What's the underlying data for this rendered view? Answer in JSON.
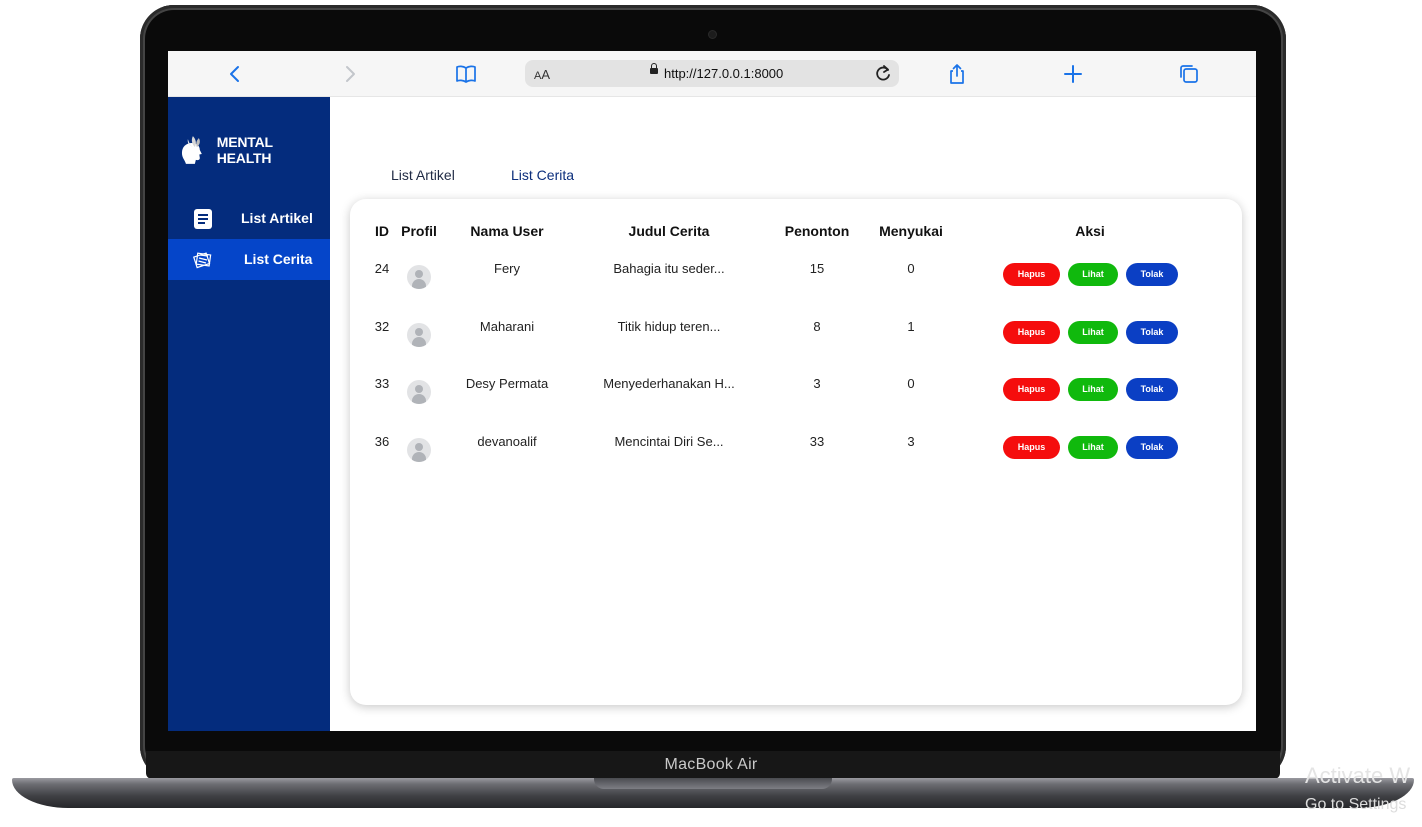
{
  "device": {
    "brand_label": "MacBook Air"
  },
  "os_watermark": {
    "line1": "Activate W",
    "line2": "Go to Settings"
  },
  "browser": {
    "text_size_label_small": "A",
    "text_size_label_large": "A",
    "url": "http://127.0.0.1:8000"
  },
  "sidebar": {
    "logo_text": "MENTAL HEALTH",
    "items": [
      {
        "label": "List Artikel",
        "icon": "document-icon",
        "active": false
      },
      {
        "label": "List Cerita",
        "icon": "stories-icon",
        "active": true
      }
    ]
  },
  "tabs": [
    {
      "label": "List Artikel"
    },
    {
      "label": "List Cerita"
    }
  ],
  "table": {
    "headers": [
      "ID",
      "Profil",
      "Nama User",
      "Judul Cerita",
      "Penonton",
      "Menyukai",
      "Aksi"
    ],
    "rows": [
      {
        "id": "24",
        "name": "Fery",
        "title": "Bahagia itu seder...",
        "views": "15",
        "likes": "0"
      },
      {
        "id": "32",
        "name": "Maharani",
        "title": "Titik hidup teren...",
        "views": "8",
        "likes": "1"
      },
      {
        "id": "33",
        "name": "Desy Permata",
        "title": "Menyederhanakan H...",
        "views": "3",
        "likes": "0"
      },
      {
        "id": "36",
        "name": "devanoalif",
        "title": "Mencintai Diri Se...",
        "views": "33",
        "likes": "3"
      }
    ],
    "actions": {
      "delete": "Hapus",
      "view": "Lihat",
      "reject": "Tolak"
    }
  },
  "colors": {
    "sidebar_bg": "#042c7d",
    "sidebar_active": "#0545c9",
    "delete_button": "#f50d0d",
    "view_button": "#10b90d",
    "reject_button": "#0b3fc4",
    "browser_accent": "#1a73e8"
  }
}
